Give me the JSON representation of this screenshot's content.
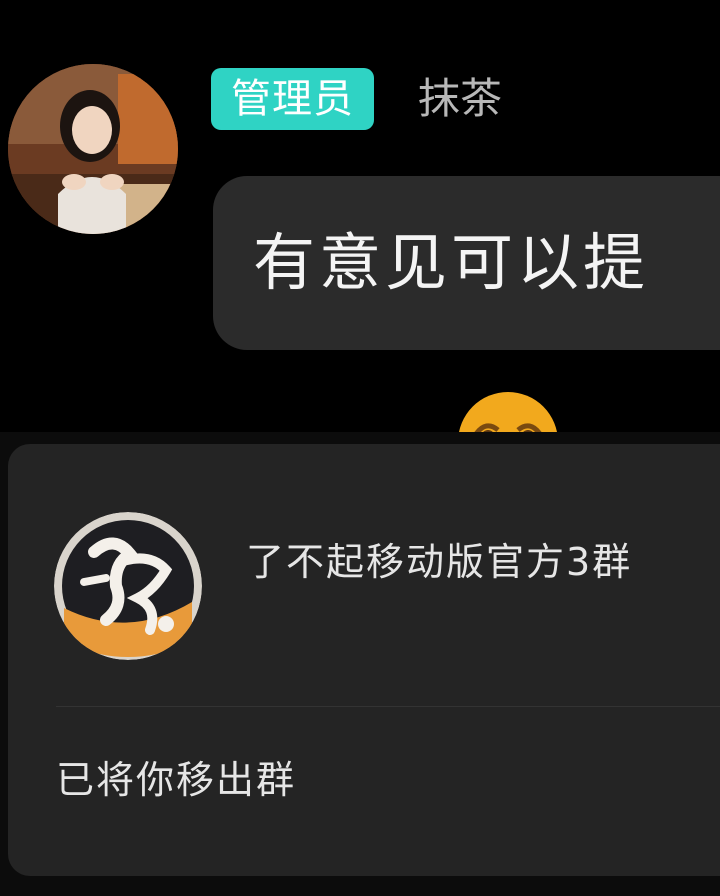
{
  "chat": {
    "role_badge": "管理员",
    "sender_name": "抹茶",
    "message": "有意见可以提"
  },
  "notice": {
    "group_name": "了不起移动版官方3群",
    "message": "已将你移出群"
  },
  "colors": {
    "background": "#000000",
    "badge": "#2fd3c4",
    "bubble": "#2b2b2b",
    "card": "#242424",
    "emoji": "#f2a91d"
  },
  "icons": {
    "avatar": "user-photo-avatar",
    "group_avatar": "group-logo-avatar",
    "emoji": "crying-face-emoji"
  }
}
